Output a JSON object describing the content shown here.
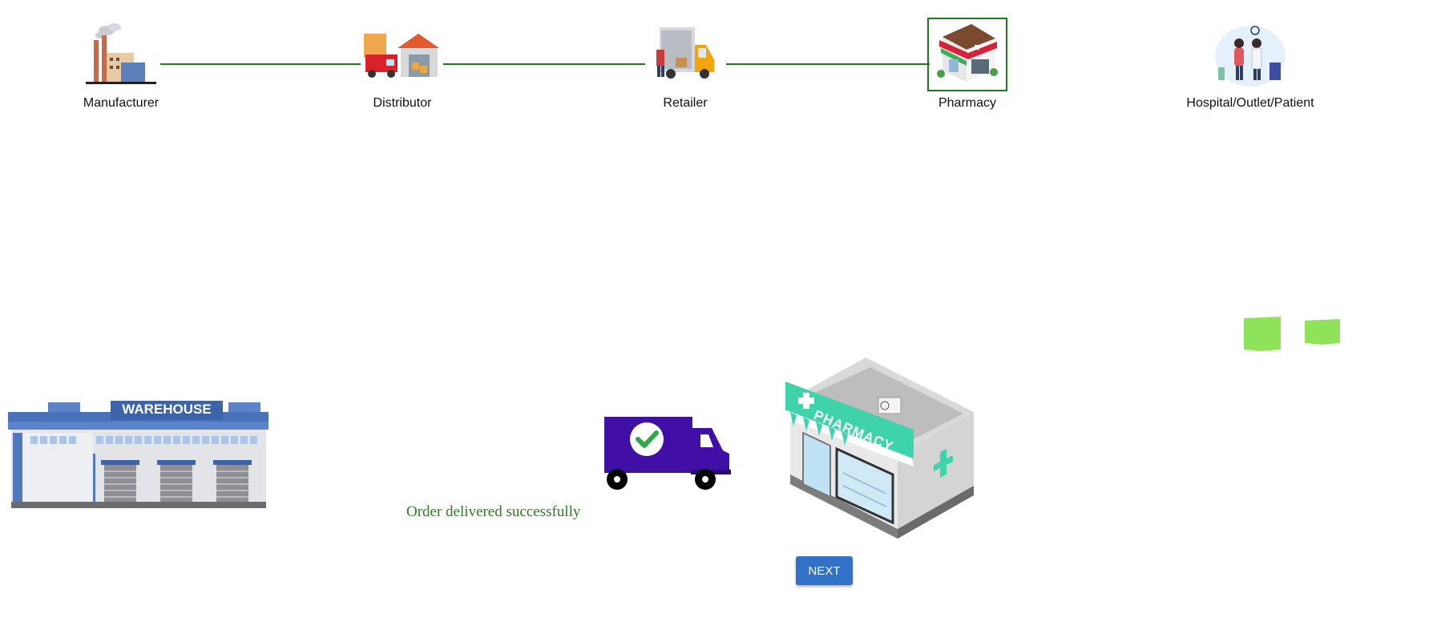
{
  "steps": [
    {
      "label": "Manufacturer",
      "icon": "factory-icon",
      "active": false
    },
    {
      "label": "Distributor",
      "icon": "distribution-truck-icon",
      "active": false
    },
    {
      "label": "Retailer",
      "icon": "retail-delivery-van-icon",
      "active": false
    },
    {
      "label": "Pharmacy",
      "icon": "pharmacy-store-icon",
      "active": true
    },
    {
      "label": "Hospital/Outlet/Patient",
      "icon": "hospital-patient-icon",
      "active": false
    }
  ],
  "scene": {
    "warehouse_sign": "WAREHOUSE",
    "pharmacy_sign": "PHARMACY",
    "status_message": "Order delivered successfully"
  },
  "actions": {
    "next_label": "NEXT"
  },
  "colors": {
    "connector": "#1e7b1e",
    "status_text": "#2e7d1e",
    "next_button": "#3171c7",
    "truck": "#3f0fa6",
    "package": "#8fe35a"
  }
}
